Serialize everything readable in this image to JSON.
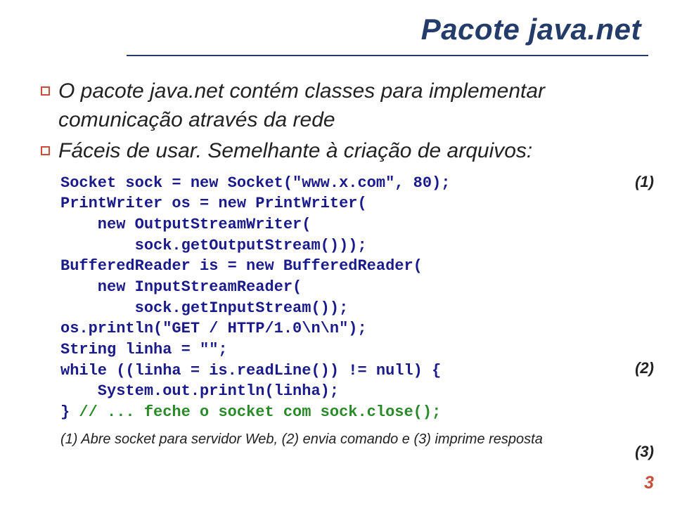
{
  "title": "Pacote java.net",
  "bullets": [
    "O pacote java.net contém classes para implementar comunicação através da rede",
    "Fáceis de usar. Semelhante à criação de arquivos:"
  ],
  "code": {
    "l1": "Socket sock = new Socket(\"www.x.com\", 80);",
    "l2": "PrintWriter os = new PrintWriter(",
    "l3": "    new OutputStreamWriter(",
    "l4": "        sock.getOutputStream()));",
    "l5": "BufferedReader is = new BufferedReader(",
    "l6": "    new InputStreamReader(",
    "l7": "        sock.getInputStream());",
    "l8": "os.println(\"GET / HTTP/1.0\\n\\n\");",
    "l9": "String linha = \"\";",
    "l10": "while ((linha = is.readLine()) != null) {",
    "l11": "    System.out.println(linha);",
    "l12a": "} ",
    "l12b": "// ... feche o socket com sock.close();"
  },
  "notes": {
    "n1": "(1)",
    "n2": "(2)",
    "n3": "(3)"
  },
  "footline": "(1) Abre socket para servidor Web, (2) envia comando e (3) imprime resposta",
  "page": "3"
}
